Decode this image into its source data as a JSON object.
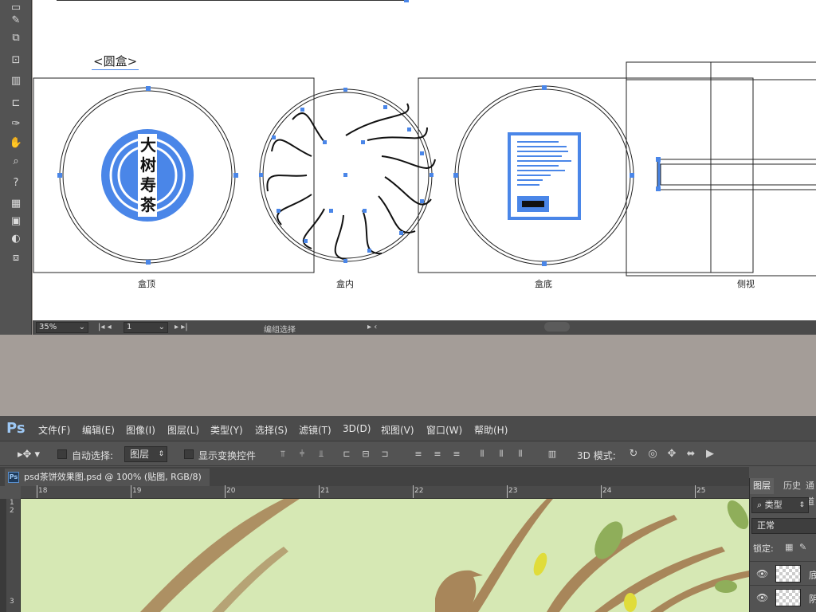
{
  "illustrator": {
    "section_title": "<圆盒>",
    "panel_labels": {
      "top": "盒顶",
      "inner": "盒内",
      "bottom": "盒底",
      "side": "侧视"
    },
    "logo_text": [
      "大",
      "树",
      "寿",
      "茶"
    ],
    "status": {
      "zoom": "35%",
      "page": "1",
      "tool_label": "编组选择"
    },
    "tools": [
      "rect-tool-icon",
      "eyedropper-icon",
      "blend-icon",
      "symbol-sprayer-icon",
      "graph-icon",
      "artboard-icon",
      "slice-icon",
      "hand-icon",
      "zoom-icon",
      "color-swatches-icon",
      "screen-mode-icon"
    ]
  },
  "photoshop": {
    "logo": "Ps",
    "menu": [
      "文件(F)",
      "编辑(E)",
      "图像(I)",
      "图层(L)",
      "类型(Y)",
      "选择(S)",
      "滤镜(T)",
      "3D(D)",
      "视图(V)",
      "窗口(W)",
      "帮助(H)"
    ],
    "options": {
      "auto_select_label": "自动选择:",
      "auto_select_value": "图层",
      "show_transform_label": "显示变换控件",
      "mode_3d_label": "3D 模式:"
    },
    "document_tab": "psd茶饼效果图.psd @ 100% (贴图, RGB/8)",
    "ruler_top": [
      "18",
      "19",
      "20",
      "21",
      "22",
      "23",
      "24",
      "25"
    ],
    "ruler_left": [
      "1",
      "2",
      "3"
    ],
    "layers_panel": {
      "tabs": [
        "图层",
        "历史",
        "通道"
      ],
      "filter_label": "类型",
      "blend_mode": "正常",
      "lock_label": "锁定:",
      "layers": [
        {
          "name": "底"
        },
        {
          "name": "阴"
        }
      ]
    },
    "canvas_colors": {
      "background": "#d6e8b4",
      "brush": "#a8865a",
      "leaf": "#8fae5a",
      "yellow": "#e0dc3a"
    }
  },
  "colors": {
    "selection_blue": "#4a86e8",
    "ps_panel": "#535353",
    "ai_toolbar": "#535353"
  }
}
